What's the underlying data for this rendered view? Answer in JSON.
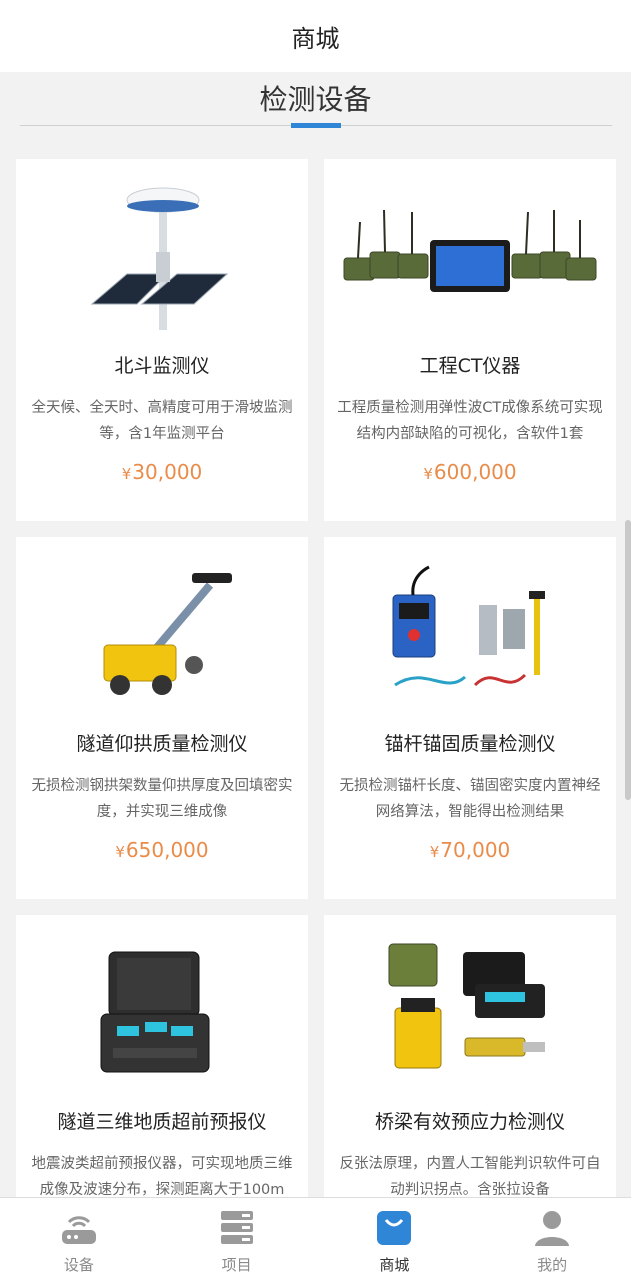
{
  "header": {
    "title": "商城"
  },
  "section": {
    "title": "检测设备"
  },
  "colors": {
    "accent": "#2f86d6",
    "price": "#e98c4a",
    "active_tab": "#2f86d6",
    "inactive_tab": "#9a9a9a"
  },
  "products": [
    {
      "name": "北斗监测仪",
      "desc": "全天候、全天时、高精度可用于滑坡监测等，含1年监测平台",
      "currency": "¥",
      "price": "30,000",
      "image_icon": "beidou-monitor-icon"
    },
    {
      "name": "工程CT仪器",
      "desc": "工程质量检测用弹性波CT成像系统可实现结构内部缺陷的可视化，含软件1套",
      "currency": "¥",
      "price": "600,000",
      "image_icon": "engineering-ct-icon"
    },
    {
      "name": "隧道仰拱质量检测仪",
      "desc": "无损检测钢拱架数量仰拱厚度及回填密实度，并实现三维成像",
      "currency": "¥",
      "price": "650,000",
      "image_icon": "tunnel-inverted-arch-detector-icon"
    },
    {
      "name": "锚杆锚固质量检测仪",
      "desc": "无损检测锚杆长度、锚固密实度内置神经网络算法，智能得出检测结果",
      "currency": "¥",
      "price": "70,000",
      "image_icon": "anchor-rod-detector-icon"
    },
    {
      "name": "隧道三维地质超前预报仪",
      "desc": "地震波类超前预报仪器，可实现地质三维成像及波速分布，探测距离大于100m",
      "currency": "",
      "price": "",
      "image_icon": "tunnel-3d-geology-forecaster-icon"
    },
    {
      "name": "桥梁有效预应力检测仪",
      "desc": "反张法原理，内置人工智能判识软件可自动判识拐点。含张拉设备",
      "currency": "",
      "price": "",
      "image_icon": "bridge-prestress-detector-icon"
    }
  ],
  "tabbar": {
    "items": [
      {
        "label": "设备",
        "icon": "router-icon",
        "active": false
      },
      {
        "label": "项目",
        "icon": "server-list-icon",
        "active": false
      },
      {
        "label": "商城",
        "icon": "shopping-bag-icon",
        "active": true
      },
      {
        "label": "我的",
        "icon": "user-icon",
        "active": false
      }
    ]
  }
}
